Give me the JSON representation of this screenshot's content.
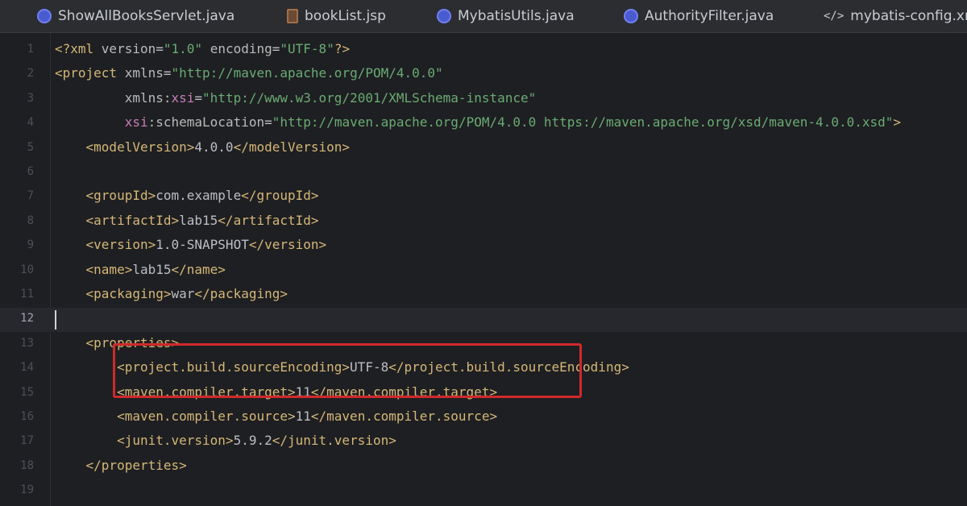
{
  "tabs": [
    {
      "label": "ShowAllBooksServlet.java",
      "icon": "java-class-icon"
    },
    {
      "label": "bookList.jsp",
      "icon": "jsp-file-icon"
    },
    {
      "label": "MybatisUtils.java",
      "icon": "java-class-icon"
    },
    {
      "label": "AuthorityFilter.java",
      "icon": "java-class-icon"
    },
    {
      "label": "mybatis-config.xml",
      "icon": "xml-file-icon"
    }
  ],
  "editor": {
    "current_line": "12",
    "lines": [
      {
        "n": "1",
        "segments": [
          [
            "t",
            "<?xml "
          ],
          [
            "a",
            "version"
          ],
          [
            "tx",
            "="
          ],
          [
            "s",
            "\"1.0\""
          ],
          [
            "tx",
            " "
          ],
          [
            "a",
            "encoding"
          ],
          [
            "tx",
            "="
          ],
          [
            "s",
            "\"UTF-8\""
          ],
          [
            "t",
            "?>"
          ]
        ]
      },
      {
        "n": "2",
        "segments": [
          [
            "t",
            "<project "
          ],
          [
            "a",
            "xmlns"
          ],
          [
            "tx",
            "="
          ],
          [
            "s",
            "\"http://maven.apache.org/POM/4.0.0\""
          ]
        ]
      },
      {
        "n": "3",
        "segments": [
          [
            "tx",
            "         "
          ],
          [
            "a",
            "xmlns:"
          ],
          [
            "ns",
            "xsi"
          ],
          [
            "tx",
            "="
          ],
          [
            "s",
            "\"http://www.w3.org/2001/XMLSchema-instance\""
          ]
        ]
      },
      {
        "n": "4",
        "segments": [
          [
            "tx",
            "         "
          ],
          [
            "ns",
            "xsi"
          ],
          [
            "a",
            ":schemaLocation"
          ],
          [
            "tx",
            "="
          ],
          [
            "s",
            "\"http://maven.apache.org/POM/4.0.0 https://maven.apache.org/xsd/maven-4.0.0.xsd\""
          ],
          [
            "t",
            ">"
          ]
        ]
      },
      {
        "n": "5",
        "segments": [
          [
            "tx",
            "    "
          ],
          [
            "t",
            "<modelVersion>"
          ],
          [
            "tx",
            "4.0.0"
          ],
          [
            "t",
            "</modelVersion>"
          ]
        ]
      },
      {
        "n": "6",
        "segments": []
      },
      {
        "n": "7",
        "segments": [
          [
            "tx",
            "    "
          ],
          [
            "t",
            "<groupId>"
          ],
          [
            "tx",
            "com.example"
          ],
          [
            "t",
            "</groupId>"
          ]
        ]
      },
      {
        "n": "8",
        "segments": [
          [
            "tx",
            "    "
          ],
          [
            "t",
            "<artifactId>"
          ],
          [
            "tx",
            "lab15"
          ],
          [
            "t",
            "</artifactId>"
          ]
        ]
      },
      {
        "n": "9",
        "segments": [
          [
            "tx",
            "    "
          ],
          [
            "t",
            "<version>"
          ],
          [
            "tx",
            "1.0-SNAPSHOT"
          ],
          [
            "t",
            "</version>"
          ]
        ]
      },
      {
        "n": "10",
        "segments": [
          [
            "tx",
            "    "
          ],
          [
            "t",
            "<name>"
          ],
          [
            "tx",
            "lab15"
          ],
          [
            "t",
            "</name>"
          ]
        ]
      },
      {
        "n": "11",
        "segments": [
          [
            "tx",
            "    "
          ],
          [
            "t",
            "<packaging>"
          ],
          [
            "tx",
            "war"
          ],
          [
            "t",
            "</packaging>"
          ]
        ]
      },
      {
        "n": "12",
        "segments": []
      },
      {
        "n": "13",
        "segments": [
          [
            "tx",
            "    "
          ],
          [
            "t",
            "<properties>"
          ]
        ]
      },
      {
        "n": "14",
        "segments": [
          [
            "tx",
            "        "
          ],
          [
            "t",
            "<project.build.sourceEncoding>"
          ],
          [
            "tx",
            "UTF-8"
          ],
          [
            "t",
            "</project.build.sourceEncoding>"
          ]
        ]
      },
      {
        "n": "15",
        "segments": [
          [
            "tx",
            "        "
          ],
          [
            "t",
            "<maven.compiler.target>"
          ],
          [
            "tx",
            "11"
          ],
          [
            "t",
            "</maven.compiler.target>"
          ]
        ]
      },
      {
        "n": "16",
        "segments": [
          [
            "tx",
            "        "
          ],
          [
            "t",
            "<maven.compiler.source>"
          ],
          [
            "tx",
            "11"
          ],
          [
            "t",
            "</maven.compiler.source>"
          ]
        ]
      },
      {
        "n": "17",
        "segments": [
          [
            "tx",
            "        "
          ],
          [
            "t",
            "<junit.version>"
          ],
          [
            "tx",
            "5.9.2"
          ],
          [
            "t",
            "</junit.version>"
          ]
        ]
      },
      {
        "n": "18",
        "segments": [
          [
            "tx",
            "    "
          ],
          [
            "t",
            "</properties>"
          ]
        ]
      },
      {
        "n": "19",
        "segments": []
      }
    ]
  },
  "colors": {
    "background": "#1e1f22",
    "tabbar": "#2b2d30",
    "tag": "#d5b778",
    "string": "#6aab73",
    "namespace": "#c77dbb",
    "highlight_box": "#d0292b"
  }
}
